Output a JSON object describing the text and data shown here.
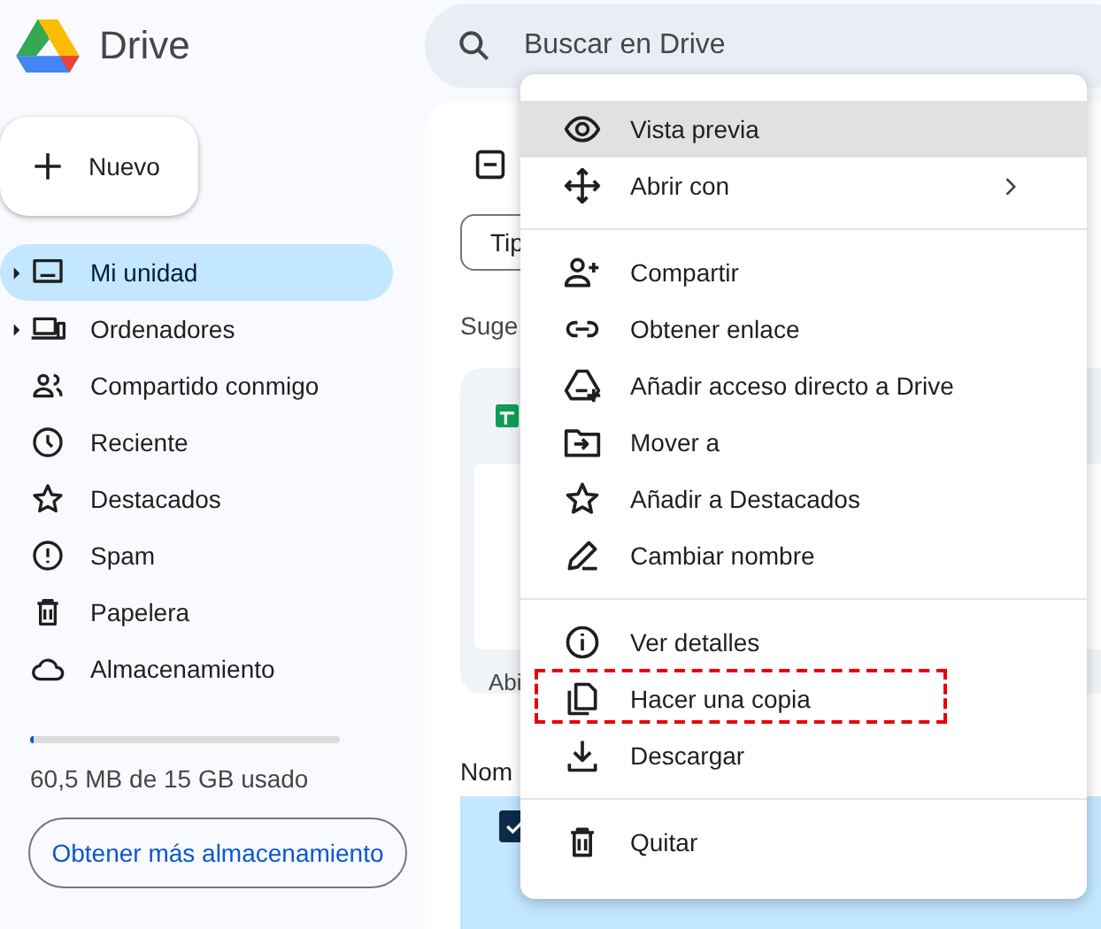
{
  "app": {
    "name": "Drive"
  },
  "search": {
    "placeholder": "Buscar en Drive"
  },
  "new_button": {
    "label": "Nuevo"
  },
  "sidebar": {
    "items": [
      {
        "label": "Mi unidad",
        "selected": true,
        "expandable": true
      },
      {
        "label": "Ordenadores",
        "selected": false,
        "expandable": true
      },
      {
        "label": "Compartido conmigo",
        "selected": false,
        "expandable": false
      },
      {
        "label": "Reciente",
        "selected": false,
        "expandable": false
      },
      {
        "label": "Destacados",
        "selected": false,
        "expandable": false
      },
      {
        "label": "Spam",
        "selected": false,
        "expandable": false
      },
      {
        "label": "Papelera",
        "selected": false,
        "expandable": false
      },
      {
        "label": "Almacenamiento",
        "selected": false,
        "expandable": false
      }
    ]
  },
  "storage": {
    "level": 0.01,
    "usage": "60,5 MB de 15 GB usado",
    "button": "Obtener más almacenamiento"
  },
  "main": {
    "filter_chip": "Tip",
    "section": "Suge",
    "card_caption": "Abi",
    "column_header": "Nom",
    "row": {
      "selected": true,
      "checked": true
    }
  },
  "context_menu": {
    "items": [
      {
        "kind": "item",
        "label": "Vista previa",
        "selected": true,
        "submenu": false,
        "highlighted": false
      },
      {
        "kind": "item",
        "label": "Abrir con",
        "selected": false,
        "submenu": true,
        "highlighted": false
      },
      {
        "kind": "divider"
      },
      {
        "kind": "item",
        "label": "Compartir",
        "selected": false,
        "submenu": false,
        "highlighted": false
      },
      {
        "kind": "item",
        "label": "Obtener enlace",
        "selected": false,
        "submenu": false,
        "highlighted": false
      },
      {
        "kind": "item",
        "label": "Añadir acceso directo a Drive",
        "selected": false,
        "submenu": false,
        "highlighted": false
      },
      {
        "kind": "item",
        "label": "Mover a",
        "selected": false,
        "submenu": false,
        "highlighted": false
      },
      {
        "kind": "item",
        "label": "Añadir a Destacados",
        "selected": false,
        "submenu": false,
        "highlighted": false
      },
      {
        "kind": "item",
        "label": "Cambiar nombre",
        "selected": false,
        "submenu": false,
        "highlighted": false
      },
      {
        "kind": "divider"
      },
      {
        "kind": "item",
        "label": "Ver detalles",
        "selected": false,
        "submenu": false,
        "highlighted": false
      },
      {
        "kind": "item",
        "label": "Hacer una copia",
        "selected": false,
        "submenu": false,
        "highlighted": true
      },
      {
        "kind": "item",
        "label": "Descargar",
        "selected": false,
        "submenu": false,
        "highlighted": false
      },
      {
        "kind": "divider"
      },
      {
        "kind": "item",
        "label": "Quitar",
        "selected": false,
        "submenu": false,
        "highlighted": false
      }
    ]
  }
}
